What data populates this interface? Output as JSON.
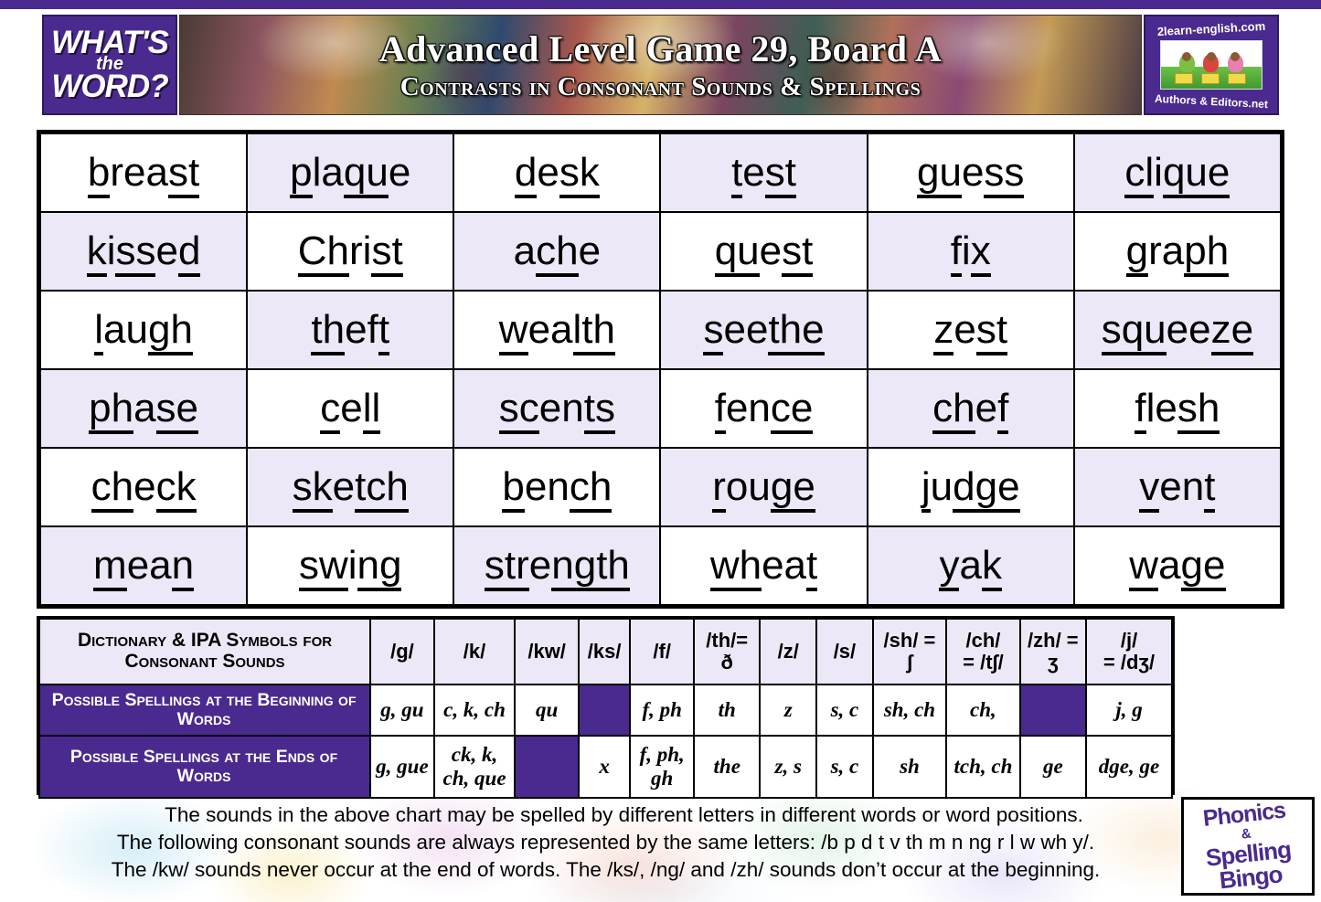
{
  "brand": {
    "logo_left_line1": "WHAT'S",
    "logo_left_line2": "the",
    "logo_left_line3": "WORD?",
    "logo_right_top": "2learn-english.com",
    "logo_right_bottom": "Authors & Editors.net",
    "bingo_logo_line1": "Phonics",
    "bingo_logo_line2": "&",
    "bingo_logo_line3": "Spelling",
    "bingo_logo_line4": "Bingo"
  },
  "header": {
    "title": "Advanced Level Game 29, Board A",
    "subtitle": "Contrasts in Consonant Sounds & Spellings"
  },
  "colors": {
    "purple": "#4A2A8F",
    "lavender": "#EDE8F7",
    "white": "#FFFFFF",
    "black": "#000000"
  },
  "bingo_grid": {
    "rows": 6,
    "cols": 6,
    "cells": [
      [
        {
          "word": "breast",
          "parts": [
            {
              "t": "b",
              "u": true
            },
            {
              "t": "rea",
              "u": false
            },
            {
              "t": "st",
              "u": true
            }
          ]
        },
        {
          "word": "plaque",
          "parts": [
            {
              "t": "p",
              "u": true
            },
            {
              "t": "la",
              "u": false
            },
            {
              "t": "qu",
              "u": true
            },
            {
              "t": "e",
              "u": false
            }
          ]
        },
        {
          "word": "desk",
          "parts": [
            {
              "t": "d",
              "u": true
            },
            {
              "t": "e",
              "u": false
            },
            {
              "t": "sk",
              "u": true
            }
          ]
        },
        {
          "word": "test",
          "parts": [
            {
              "t": "t",
              "u": true
            },
            {
              "t": "e",
              "u": false
            },
            {
              "t": "st",
              "u": true
            }
          ]
        },
        {
          "word": "guess",
          "parts": [
            {
              "t": "gu",
              "u": true
            },
            {
              "t": "e",
              "u": false
            },
            {
              "t": "ss",
              "u": true
            }
          ]
        },
        {
          "word": "clique",
          "parts": [
            {
              "t": "cl",
              "u": true
            },
            {
              "t": "i",
              "u": false
            },
            {
              "t": "que",
              "u": true
            }
          ]
        }
      ],
      [
        {
          "word": "kissed",
          "parts": [
            {
              "t": "k",
              "u": true
            },
            {
              "t": "i",
              "u": false
            },
            {
              "t": "ss",
              "u": true
            },
            {
              "t": "e",
              "u": false
            },
            {
              "t": "d",
              "u": true
            }
          ]
        },
        {
          "word": "Christ",
          "parts": [
            {
              "t": "Ch",
              "u": true
            },
            {
              "t": "ri",
              "u": false
            },
            {
              "t": "st",
              "u": true
            }
          ]
        },
        {
          "word": "ache",
          "parts": [
            {
              "t": "a",
              "u": false
            },
            {
              "t": "ch",
              "u": true
            },
            {
              "t": "e",
              "u": false
            }
          ]
        },
        {
          "word": "quest",
          "parts": [
            {
              "t": "qu",
              "u": true
            },
            {
              "t": "e",
              "u": false
            },
            {
              "t": "st",
              "u": true
            }
          ]
        },
        {
          "word": "fix",
          "parts": [
            {
              "t": "f",
              "u": true
            },
            {
              "t": "i",
              "u": false
            },
            {
              "t": "x",
              "u": true
            }
          ]
        },
        {
          "word": "graph",
          "parts": [
            {
              "t": "g",
              "u": true
            },
            {
              "t": "ra",
              "u": false
            },
            {
              "t": "ph",
              "u": true
            }
          ]
        }
      ],
      [
        {
          "word": "laugh",
          "parts": [
            {
              "t": "l",
              "u": true
            },
            {
              "t": "au",
              "u": false
            },
            {
              "t": "gh",
              "u": true
            }
          ]
        },
        {
          "word": "theft",
          "parts": [
            {
              "t": "th",
              "u": true
            },
            {
              "t": "ef",
              "u": false
            },
            {
              "t": "t",
              "u": true
            }
          ]
        },
        {
          "word": "wealth",
          "parts": [
            {
              "t": "w",
              "u": true
            },
            {
              "t": "ea",
              "u": false
            },
            {
              "t": "lth",
              "u": true
            }
          ]
        },
        {
          "word": "seethe",
          "parts": [
            {
              "t": "s",
              "u": true
            },
            {
              "t": "ee",
              "u": false
            },
            {
              "t": "the",
              "u": true
            }
          ]
        },
        {
          "word": "zest",
          "parts": [
            {
              "t": "z",
              "u": true
            },
            {
              "t": "e",
              "u": false
            },
            {
              "t": "st",
              "u": true
            }
          ]
        },
        {
          "word": "squeeze",
          "parts": [
            {
              "t": "s",
              "u": true
            },
            {
              "t": "qu",
              "u": true
            },
            {
              "t": "ee",
              "u": false
            },
            {
              "t": "ze",
              "u": true
            }
          ]
        }
      ],
      [
        {
          "word": "phase",
          "parts": [
            {
              "t": "ph",
              "u": true
            },
            {
              "t": "a",
              "u": false
            },
            {
              "t": "se",
              "u": true
            }
          ]
        },
        {
          "word": "cell",
          "parts": [
            {
              "t": "c",
              "u": true
            },
            {
              "t": "e",
              "u": false
            },
            {
              "t": "ll",
              "u": true
            }
          ]
        },
        {
          "word": "scents",
          "parts": [
            {
              "t": "sc",
              "u": true
            },
            {
              "t": "en",
              "u": false
            },
            {
              "t": "ts",
              "u": true
            }
          ]
        },
        {
          "word": "fence",
          "parts": [
            {
              "t": "f",
              "u": true
            },
            {
              "t": "en",
              "u": false
            },
            {
              "t": "ce",
              "u": true
            }
          ]
        },
        {
          "word": "chef",
          "parts": [
            {
              "t": "ch",
              "u": true
            },
            {
              "t": "e",
              "u": false
            },
            {
              "t": "f",
              "u": true
            }
          ]
        },
        {
          "word": "flesh",
          "parts": [
            {
              "t": "f",
              "u": true
            },
            {
              "t": "le",
              "u": false
            },
            {
              "t": "sh",
              "u": true
            }
          ]
        }
      ],
      [
        {
          "word": "check",
          "parts": [
            {
              "t": "ch",
              "u": true
            },
            {
              "t": "e",
              "u": false
            },
            {
              "t": "ck",
              "u": true
            }
          ]
        },
        {
          "word": "sketch",
          "parts": [
            {
              "t": "sk",
              "u": true
            },
            {
              "t": "e",
              "u": false
            },
            {
              "t": "tch",
              "u": true
            }
          ]
        },
        {
          "word": "bench",
          "parts": [
            {
              "t": "b",
              "u": true
            },
            {
              "t": "en",
              "u": false
            },
            {
              "t": "ch",
              "u": true
            }
          ]
        },
        {
          "word": "rouge",
          "parts": [
            {
              "t": "r",
              "u": true
            },
            {
              "t": "ou",
              "u": false
            },
            {
              "t": "ge",
              "u": true
            }
          ]
        },
        {
          "word": "judge",
          "parts": [
            {
              "t": "j",
              "u": true
            },
            {
              "t": "u",
              "u": false
            },
            {
              "t": "dge",
              "u": true
            }
          ]
        },
        {
          "word": "vent",
          "parts": [
            {
              "t": "v",
              "u": true
            },
            {
              "t": "en",
              "u": false
            },
            {
              "t": "t",
              "u": true
            }
          ]
        }
      ],
      [
        {
          "word": "mean",
          "parts": [
            {
              "t": "m",
              "u": true
            },
            {
              "t": "ea",
              "u": false
            },
            {
              "t": "n",
              "u": true
            }
          ]
        },
        {
          "word": "swing",
          "parts": [
            {
              "t": "sw",
              "u": true
            },
            {
              "t": "i",
              "u": false
            },
            {
              "t": "ng",
              "u": true
            }
          ]
        },
        {
          "word": "strength",
          "parts": [
            {
              "t": "str",
              "u": true
            },
            {
              "t": "e",
              "u": false
            },
            {
              "t": "ngth",
              "u": true
            }
          ]
        },
        {
          "word": "wheat",
          "parts": [
            {
              "t": "wh",
              "u": true
            },
            {
              "t": "ea",
              "u": false
            },
            {
              "t": "t",
              "u": true
            }
          ]
        },
        {
          "word": "yak",
          "parts": [
            {
              "t": "y",
              "u": true
            },
            {
              "t": "a",
              "u": false
            },
            {
              "t": "k",
              "u": true
            }
          ]
        },
        {
          "word": "wage",
          "parts": [
            {
              "t": "w",
              "u": true
            },
            {
              "t": "a",
              "u": false
            },
            {
              "t": "ge",
              "u": true
            }
          ]
        }
      ]
    ]
  },
  "chart_data": {
    "type": "table",
    "title": "Dictionary & IPA Symbols for Consonant Sounds",
    "header_label": "Dictionary & IPA Symbols for Consonant  Sounds",
    "row_labels": [
      "Possible  Spellings at the Beginning of  Words",
      "Possible Spellings at the Ends of Words"
    ],
    "columns": [
      {
        "symbol": "/g/",
        "line2": "",
        "beginning": "g, gu",
        "ends": "g, gue"
      },
      {
        "symbol": "/k/",
        "line2": "",
        "beginning": "c, k, ch",
        "ends": "ck, k, ch, que"
      },
      {
        "symbol": "/kw/",
        "line2": "",
        "beginning": "qu",
        "ends": null
      },
      {
        "symbol": "/ks/",
        "line2": "",
        "beginning": null,
        "ends": "x"
      },
      {
        "symbol": "/f/",
        "line2": "",
        "beginning": "f, ph",
        "ends": "f, ph, gh"
      },
      {
        "symbol": "/th/=",
        "line2": "ð",
        "beginning": "th",
        "ends": "the"
      },
      {
        "symbol": "/z/",
        "line2": "",
        "beginning": "z",
        "ends": "z, s"
      },
      {
        "symbol": "/s/",
        "line2": "",
        "beginning": "s, c",
        "ends": "s, c"
      },
      {
        "symbol": "/sh/ =",
        "line2": "ʃ",
        "beginning": "sh, ch",
        "ends": "sh"
      },
      {
        "symbol": "/ch/",
        "line2": "= /t∫/",
        "beginning": "ch,",
        "ends": "tch, ch"
      },
      {
        "symbol": "/zh/ =",
        "line2": "ʒ",
        "beginning": null,
        "ends": "ge"
      },
      {
        "symbol": "/j/",
        "line2": "= /dʒ/",
        "beginning": "j, g",
        "ends": "dge, ge"
      }
    ]
  },
  "footer": {
    "line1": "The sounds in the above chart may be spelled by different letters in different words or word positions.",
    "line2": "The following consonant sounds are always represented by the same letters: /b p d t v th m n ng  r l w wh y/.",
    "line3": "The /kw/ sounds never occur at the end of words. The /ks/, /ng/ and /zh/ sounds don’t occur at the beginning."
  }
}
